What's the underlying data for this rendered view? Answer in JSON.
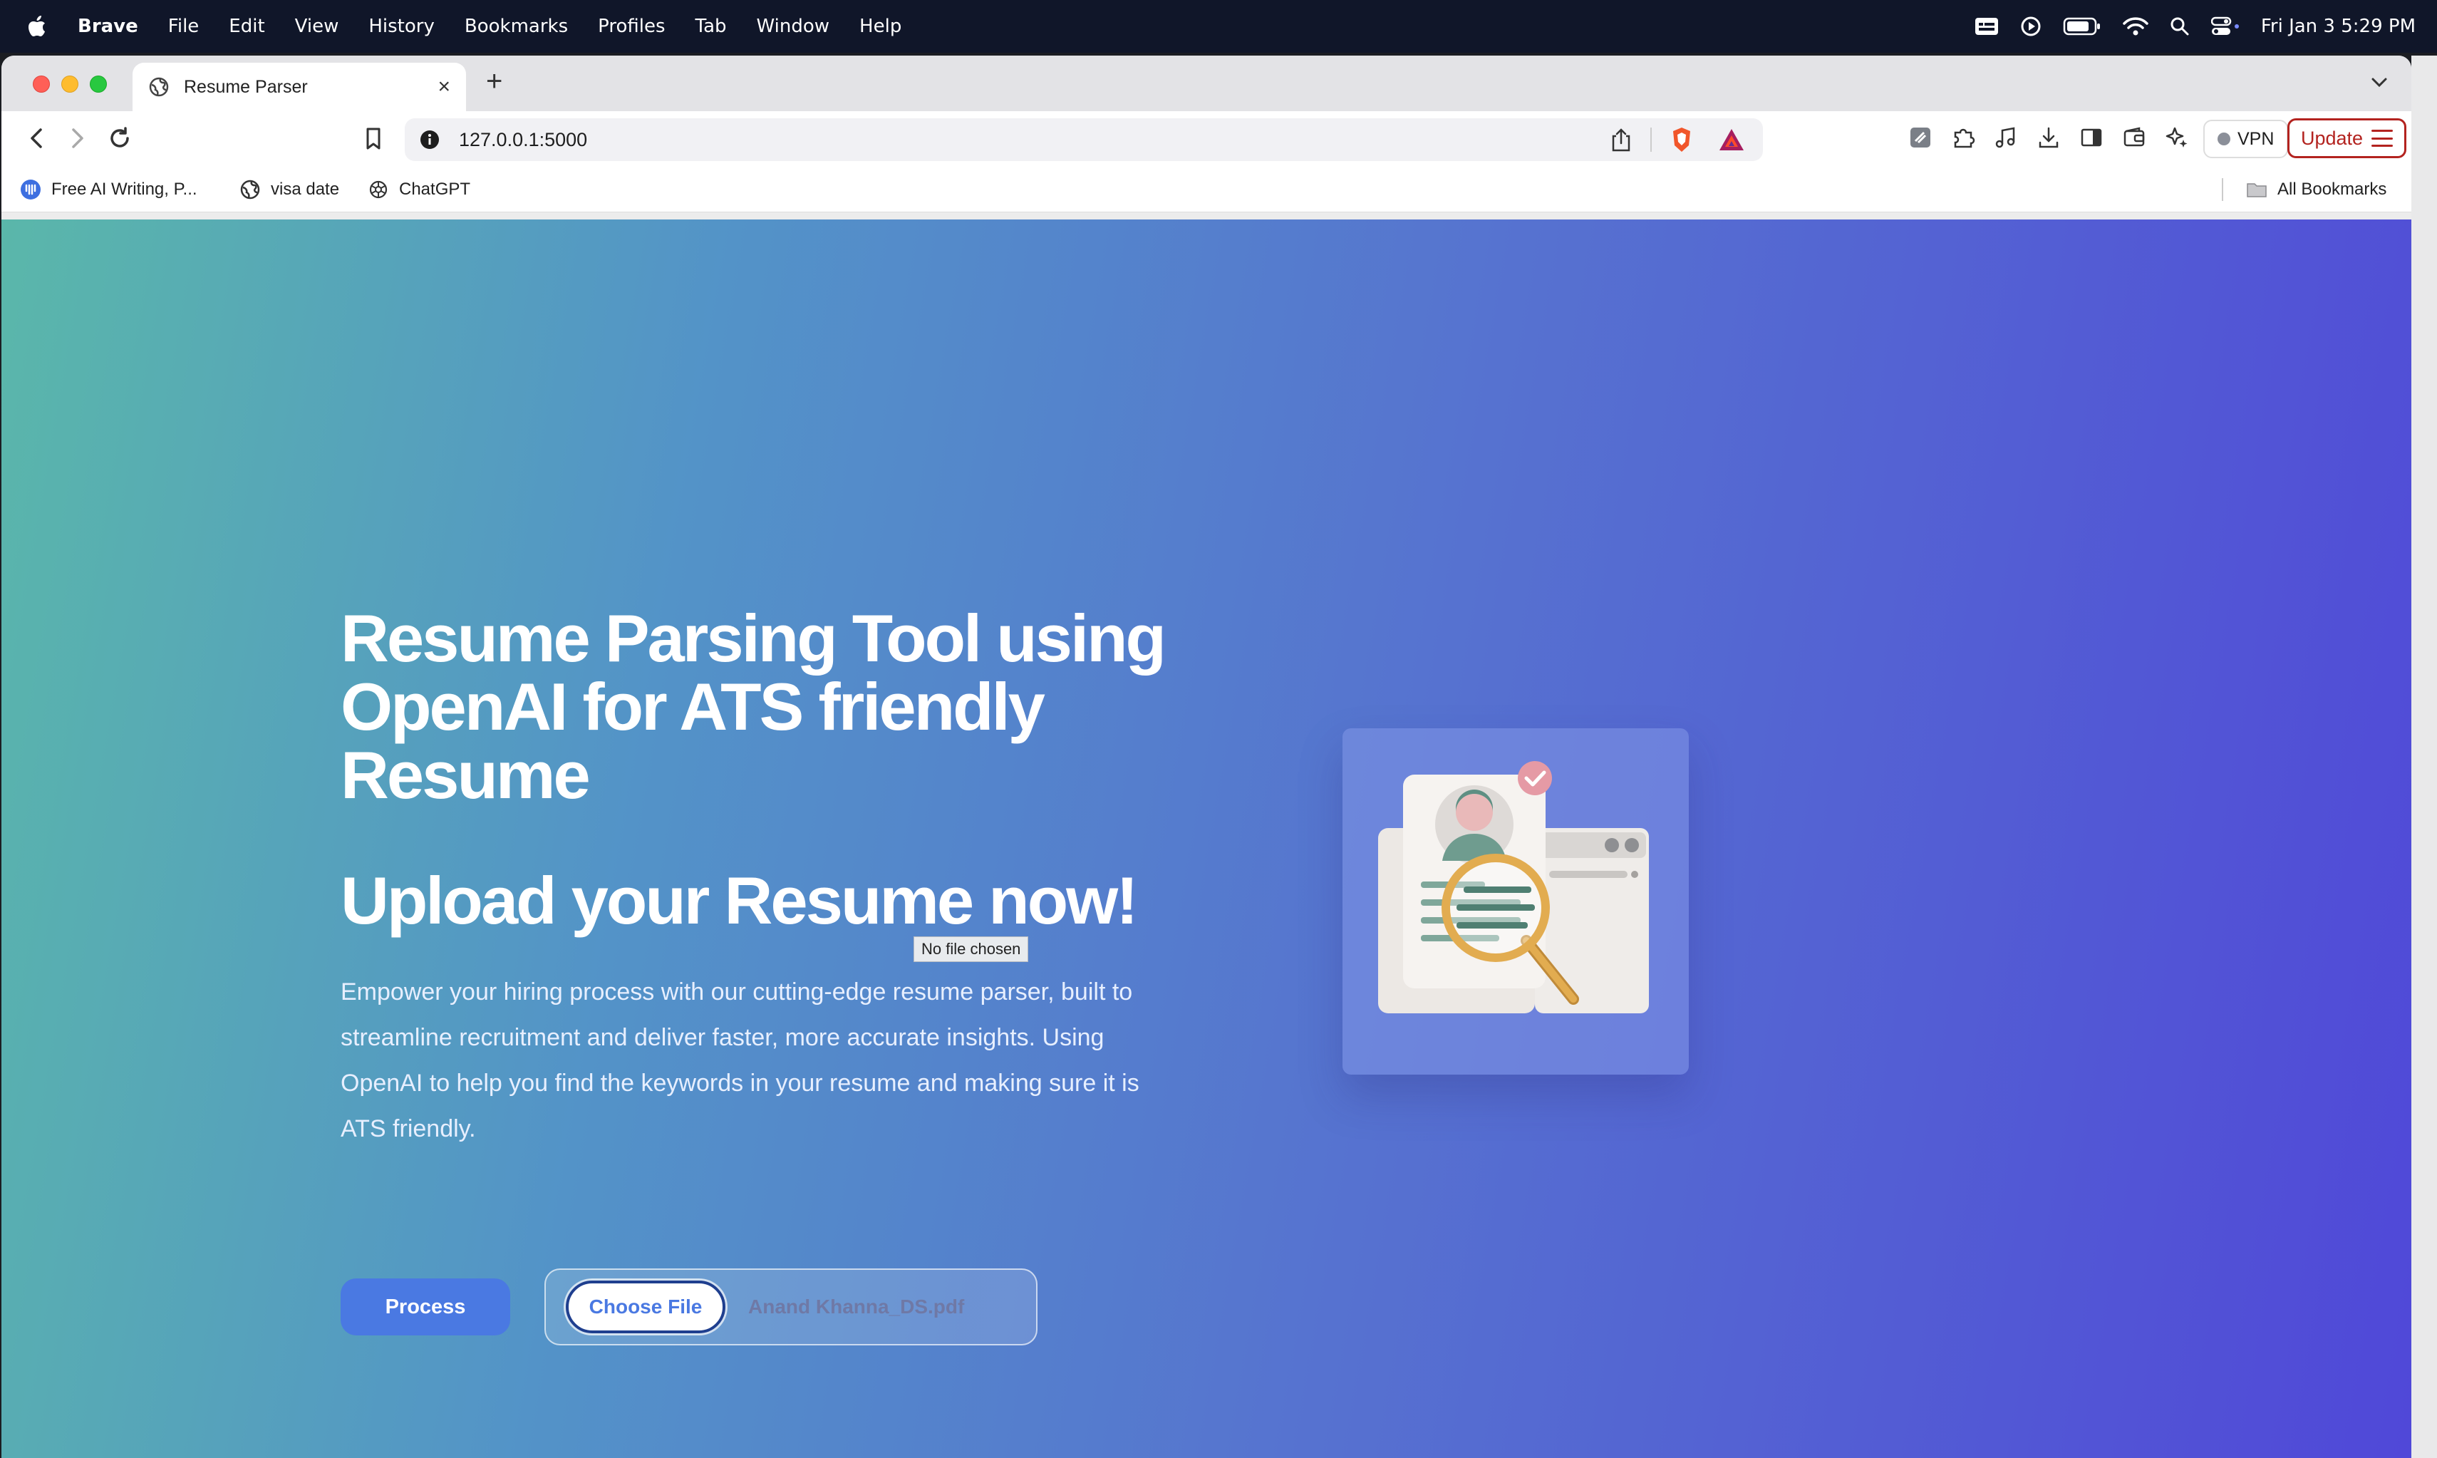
{
  "menubar": {
    "app_name": "Brave",
    "items": [
      "File",
      "Edit",
      "View",
      "History",
      "Bookmarks",
      "Profiles",
      "Tab",
      "Window",
      "Help"
    ],
    "clock": "Fri Jan 3  5:29 PM"
  },
  "browser": {
    "tab": {
      "title": "Resume Parser",
      "close": "×"
    },
    "new_tab": "+",
    "url": "127.0.0.1:5000",
    "vpn_label": "VPN",
    "update_label": "Update",
    "bookmarks": [
      {
        "label": "Free AI Writing, P...",
        "icon": "writing-app-icon"
      },
      {
        "label": "visa date",
        "icon": "globe-icon"
      },
      {
        "label": "ChatGPT",
        "icon": "chatgpt-icon"
      }
    ],
    "all_bookmarks": "All Bookmarks"
  },
  "page": {
    "title": "Resume Parsing Tool using OpenAI for ATS friendly Resume",
    "subtitle": "Upload your Resume now!",
    "tooltip": "No file chosen",
    "description": "Empower your hiring process with our cutting-edge resume parser, built to streamline recruitment and deliver faster, more accurate insights. Using OpenAI to help you find the keywords in your resume and making sure it is ATS friendly.",
    "process_button": "Process",
    "choose_file_button": "Choose File",
    "file_name": "Anand Khanna_DS.pdf"
  },
  "colors": {
    "gradient_start": "#5ab7aa",
    "gradient_end": "#5048d8",
    "primary_button": "#4a79e2",
    "update_accent": "#b3231f",
    "menubar": "#101629"
  }
}
